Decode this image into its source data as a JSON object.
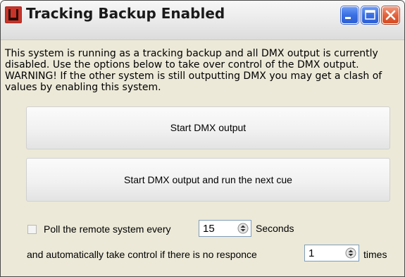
{
  "window": {
    "title": "Tracking Backup Enabled",
    "icon": "app-logo-icon",
    "controls": [
      "minimize-icon",
      "maximize-icon",
      "close-icon"
    ]
  },
  "message": "This system is running as a tracking backup and all DMX output is currently disabled. Use the options below to take over control of the DMX output. WARNING! If the other system is still outputting DMX you may get a clash of values by enabling this system.",
  "buttons": {
    "start": "Start DMX output",
    "start_and_run": "Start DMX output and run the next cue"
  },
  "poll": {
    "checked": false,
    "label": "Poll the remote system every",
    "interval": "15",
    "unit": "Seconds"
  },
  "auto_control": {
    "label": "and automatically take control  if there is no responce",
    "count": "1",
    "unit": "times"
  },
  "colors": {
    "face": "#ece9d8",
    "title_bar": "#ececec",
    "control_blue": "#3a6fe3",
    "close_red": "#e4633d",
    "icon_red": "#b3261e",
    "spinner_border": "#7f9db9"
  }
}
